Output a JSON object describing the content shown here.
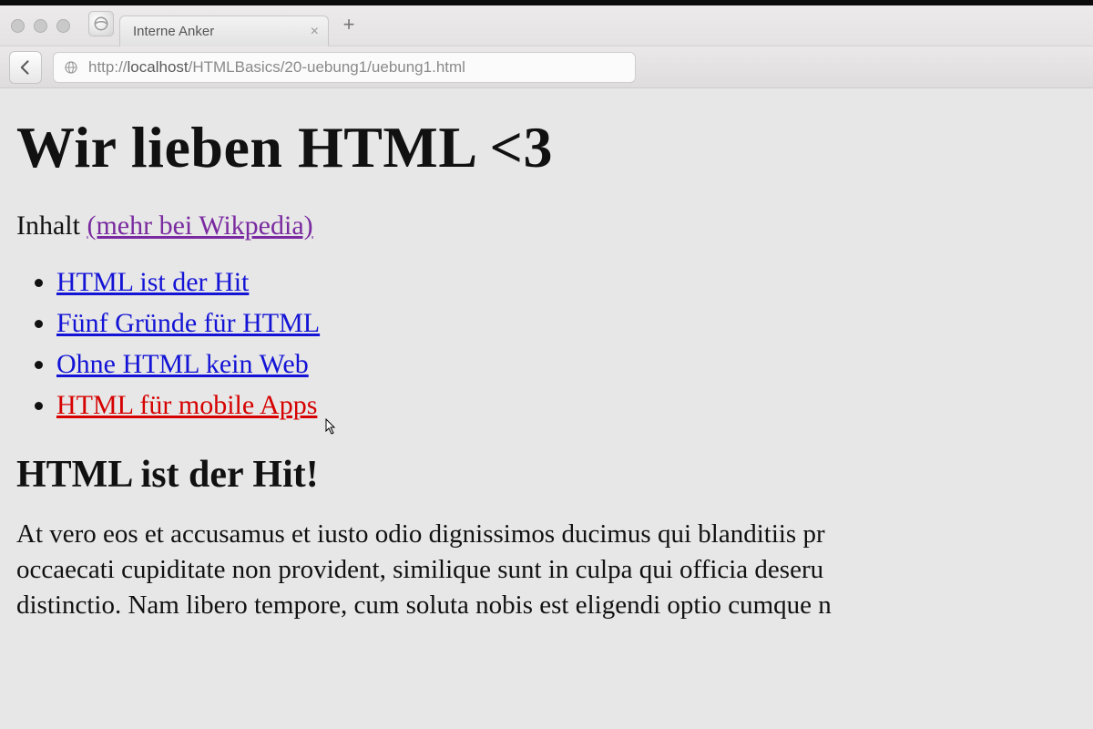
{
  "browser": {
    "tab_title": "Interne Anker",
    "url_prefix": "http://",
    "url_host": "localhost",
    "url_path": "/HTMLBasics/20-uebung1/uebung1.html"
  },
  "page": {
    "h1": "Wir lieben HTML <3",
    "toc_label": "Inhalt ",
    "toc_more_link": "(mehr bei Wikpedia)",
    "items": [
      "HTML ist der Hit",
      "Fünf Gründe für HTML",
      "Ohne HTML kein Web",
      "HTML für mobile Apps"
    ],
    "h2": "HTML ist der Hit!",
    "para1": "At vero eos et accusamus et iusto odio dignissimos ducimus qui blanditiis pr",
    "para2": "occaecati cupiditate non provident, similique sunt in culpa qui officia deseru",
    "para3": "distinctio. Nam libero tempore, cum soluta nobis est eligendi optio cumque n"
  }
}
